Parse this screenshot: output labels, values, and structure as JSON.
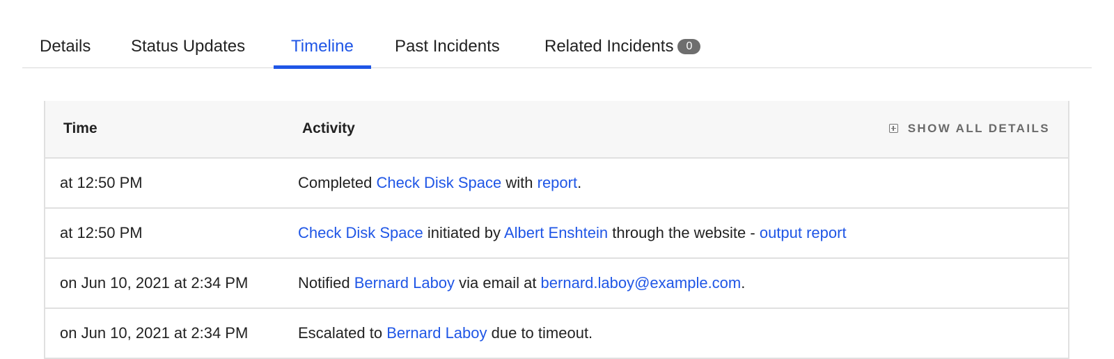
{
  "tabs": [
    {
      "label": "Details",
      "active": false
    },
    {
      "label": "Status Updates",
      "active": false
    },
    {
      "label": "Timeline",
      "active": true
    },
    {
      "label": "Past Incidents",
      "active": false
    },
    {
      "label": "Related Incidents",
      "active": false,
      "badge": "0"
    }
  ],
  "table": {
    "headers": {
      "time": "Time",
      "activity": "Activity"
    },
    "show_all_label": "SHOW ALL DETAILS",
    "show_all_icon": "plus-square-icon",
    "rows": [
      {
        "time": "at 12:50 PM",
        "parts": [
          {
            "text": "Completed "
          },
          {
            "text": "Check Disk Space",
            "link": true
          },
          {
            "text": " with "
          },
          {
            "text": "report",
            "link": true
          },
          {
            "text": "."
          }
        ]
      },
      {
        "time": "at 12:50 PM",
        "parts": [
          {
            "text": "Check Disk Space",
            "link": true
          },
          {
            "text": " initiated by "
          },
          {
            "text": "Albert Enshtein",
            "link": true
          },
          {
            "text": " through the website - "
          },
          {
            "text": "output report",
            "link": true
          }
        ]
      },
      {
        "time": "on Jun 10, 2021 at 2:34 PM",
        "parts": [
          {
            "text": "Notified "
          },
          {
            "text": "Bernard Laboy",
            "link": true
          },
          {
            "text": " via email at "
          },
          {
            "text": "bernard.laboy@example.com",
            "link": true
          },
          {
            "text": "."
          }
        ]
      },
      {
        "time": "on Jun 10, 2021 at 2:34 PM",
        "parts": [
          {
            "text": "Escalated to "
          },
          {
            "text": "Bernard Laboy",
            "link": true
          },
          {
            "text": " due to timeout."
          }
        ]
      }
    ]
  },
  "colors": {
    "accent": "#1f56e6",
    "badge": "#6e6e6e",
    "header_bg": "#f7f7f7",
    "border": "#e0e0e0"
  }
}
